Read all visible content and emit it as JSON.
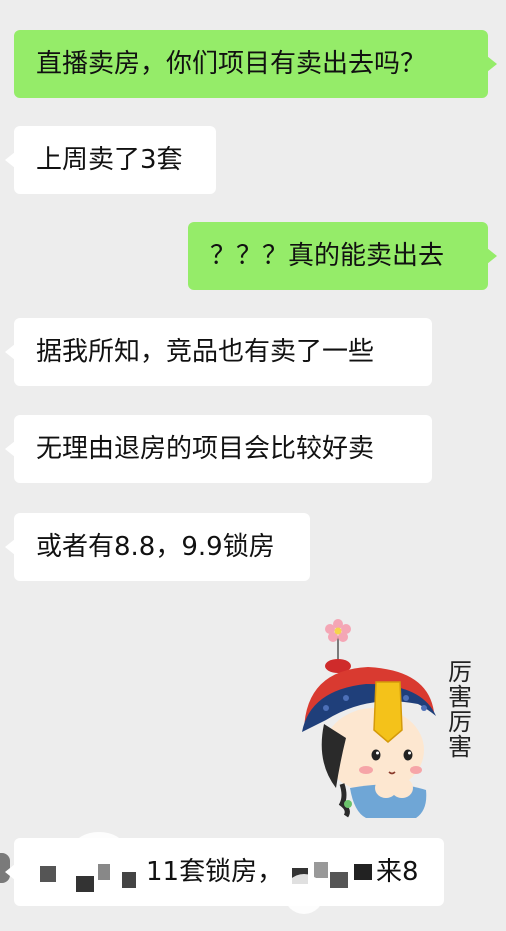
{
  "chat": {
    "messages": [
      {
        "side": "sent",
        "text": "直播卖房，你们项目有卖出去吗？"
      },
      {
        "side": "received",
        "text": "上周卖了3套"
      },
      {
        "side": "sent",
        "text": "？？？真的能卖出去"
      },
      {
        "side": "received",
        "text": "据我所知，竞品也有卖了一些"
      },
      {
        "side": "received",
        "text": "无理由退房的项目会比较好卖"
      },
      {
        "side": "received",
        "text": "或者有8.8，9.9锁房"
      },
      {
        "side": "received",
        "type": "sticker",
        "text": "厉害厉害"
      },
      {
        "side": "received",
        "text_part_a": "11套锁房，",
        "text_part_b": "来8"
      }
    ]
  },
  "colors": {
    "background": "#ededed",
    "sent_bubble": "#95ec69",
    "received_bubble": "#ffffff"
  },
  "icons": {
    "sticker": "qing-dynasty-official-cartoon-sticker",
    "flower": "flower-icon"
  }
}
